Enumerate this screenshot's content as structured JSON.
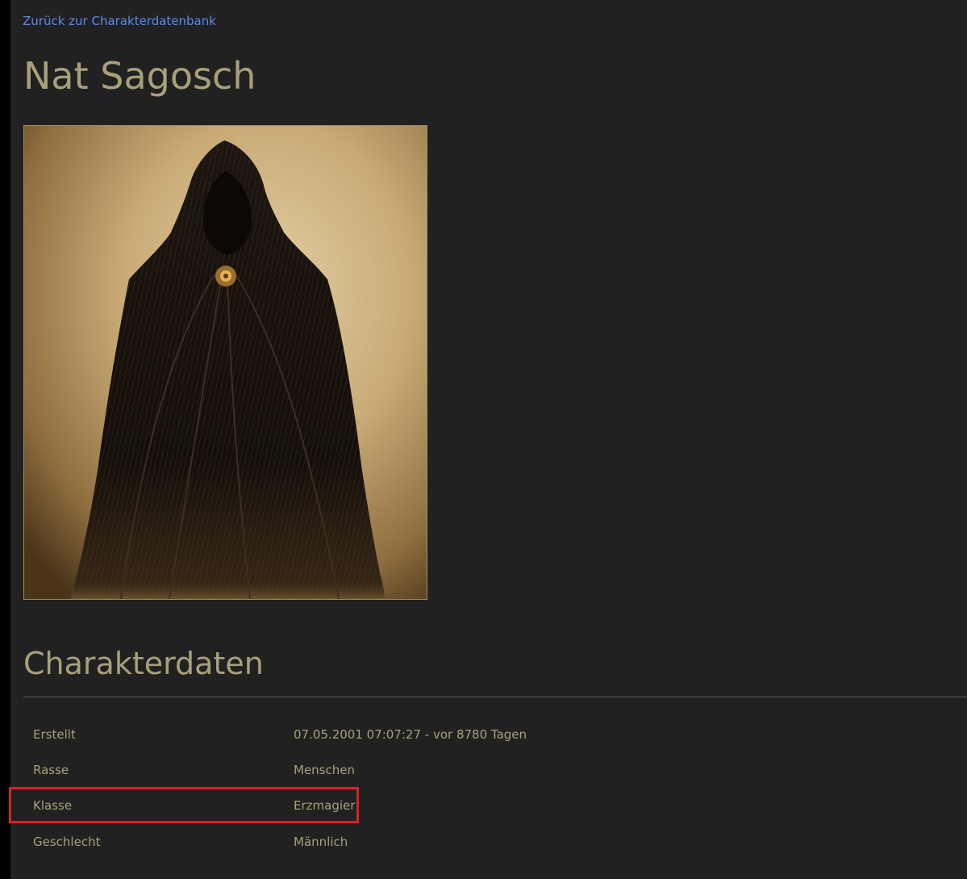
{
  "nav": {
    "back_label": "Zurück zur Charakterdatenbank"
  },
  "character": {
    "name": "Nat Sagosch",
    "portrait_icon": "hooded-cloaked-figure"
  },
  "details": {
    "section_title": "Charakterdaten",
    "rows": [
      {
        "label": "Erstellt",
        "value": "07.05.2001 07:07:27 - vor 8780 Tagen"
      },
      {
        "label": "Rasse",
        "value": "Menschen"
      },
      {
        "label": "Klasse",
        "value": "Erzmagier"
      },
      {
        "label": "Geschlecht",
        "value": "Männlich"
      }
    ]
  },
  "colors": {
    "page_bg": "#212121",
    "accent_text": "#a8a07a",
    "link": "#5b8af0",
    "highlight": "#d4232a"
  }
}
